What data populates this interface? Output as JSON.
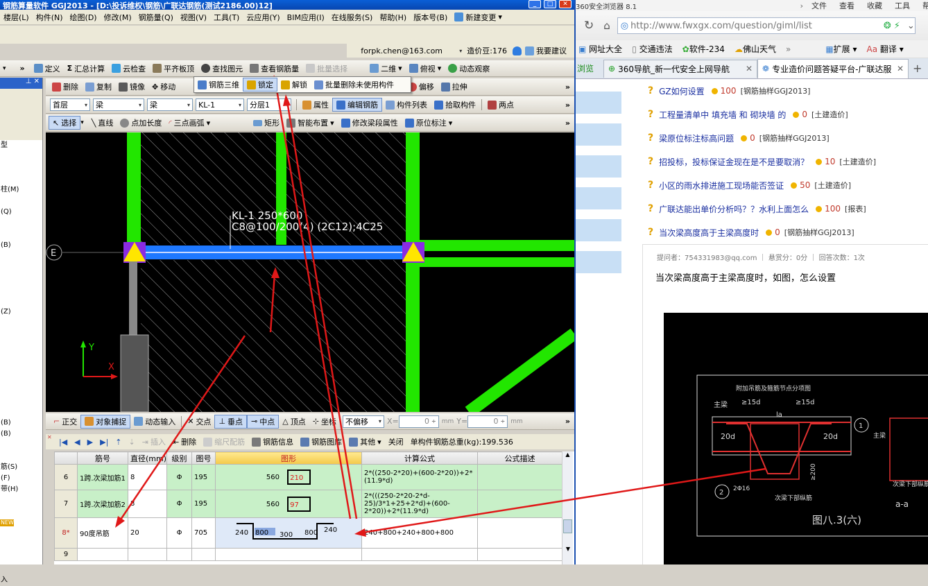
{
  "app": {
    "title": "钢筋算量软件 GGJ2013 - [D:\\投诉维权\\钢筋\\广联达钢筋(测试2186.00)12]",
    "menu": [
      "楼层(L)",
      "构件(N)",
      "绘图(D)",
      "修改(M)",
      "钢筋量(Q)",
      "视图(V)",
      "工具(T)",
      "云应用(Y)",
      "BIM应用(I)",
      "在线服务(S)",
      "帮助(H)",
      "版本号(B)",
      "新建变更"
    ],
    "account": {
      "email": "forpk.chen@163.com",
      "beans": "造价豆:176",
      "suggest": "我要建议"
    },
    "toolbar1": [
      "定义",
      "汇总计算",
      "云检查",
      "平齐板顶",
      "查找图元",
      "查看钢筋量",
      "批量选择",
      "二维",
      "俯视",
      "动态观察"
    ],
    "popup": [
      "钢筋三维",
      "锁定",
      "解锁",
      "批量删除未使用构件"
    ],
    "toolbar2": [
      "删除",
      "复制",
      "镜像",
      "移动",
      "对齐",
      "偏移",
      "拉伸"
    ],
    "combos": [
      "首层",
      "梁",
      "梁",
      "KL-1",
      "分层1"
    ],
    "toolbar3": [
      "属性",
      "编辑钢筋",
      "构件列表",
      "拾取构件",
      "两点"
    ],
    "toolbar4": [
      "选择",
      "直线",
      "点加长度",
      "三点画弧",
      "矩形",
      "智能布置",
      "修改梁段属性",
      "原位标注"
    ],
    "left_items": [
      "型",
      "",
      "",
      "",
      "柱(M)",
      "",
      "(Q)",
      "",
      "",
      "(B)",
      "",
      "",
      "",
      "",
      "",
      "(Z)",
      "",
      "",
      "",
      "",
      "",
      "",
      "",
      "",
      "",
      "(B)",
      "(B)",
      "",
      "",
      "筋(S)",
      "(F)",
      "带(H)",
      "",
      "",
      "NEW",
      "",
      "",
      "",
      "",
      "入"
    ],
    "canvas": {
      "beam_label1": "KL-1 250*600",
      "beam_label2": "C8@100/200(4) (2C12);4C25",
      "axis_e": "E",
      "axis_x": "X",
      "axis_y": "Y"
    },
    "statusbar": [
      "正交",
      "对象捕捉",
      "动态输入",
      "交点",
      "垂点",
      "中点",
      "顶点",
      "坐标",
      "不偏移"
    ],
    "status_x_label": "X=",
    "status_x": "0",
    "status_y_label": "Y=",
    "status_y": "0",
    "status_unit": "mm",
    "rebar_toolbar": [
      "插入",
      "删除",
      "缩尺配筋",
      "钢筋信息",
      "钢筋图库",
      "其他",
      "关闭"
    ],
    "total_weight": "单构件钢筋总重(kg):199.536",
    "table": {
      "headers": [
        "筋号",
        "直径(mm)",
        "级别",
        "图号",
        "图形",
        "计算公式",
        "公式描述"
      ],
      "rows": [
        {
          "idx": "6",
          "name": "1跨.次梁加筋1",
          "dia": "8",
          "grade": "Φ",
          "fig": "195",
          "shape_a": "560",
          "shape_b": "210",
          "formula": "2*((250-2*20)+(600-2*20))+2*(11.9*d)"
        },
        {
          "idx": "7",
          "name": "1跨.次梁加筋2",
          "dia": "8",
          "grade": "Φ",
          "fig": "195",
          "shape_a": "560",
          "shape_b": "97",
          "formula": "2*(((250-2*20-2*d-25)/3*1+25+2*d)+(600-2*20))+2*(11.9*d)"
        },
        {
          "idx": "8*",
          "name": "90度吊筋",
          "dia": "20",
          "grade": "Φ",
          "fig": "705",
          "shape_a": "240",
          "shape_b": "800",
          "shape_c": "300",
          "shape_d": "800",
          "shape_e": "240",
          "formula": "240+800+240+800+800"
        },
        {
          "idx": "9",
          "name": "",
          "dia": "",
          "grade": "",
          "fig": "",
          "formula": ""
        }
      ]
    }
  },
  "browser": {
    "title": "360安全浏览器 8.1",
    "menu": [
      "文件",
      "查看",
      "收藏",
      "工具",
      "帮助"
    ],
    "url": "http://www.fwxgx.com/question/giml/list",
    "bookmarks": [
      "网址大全",
      "交通违法",
      "软件-234",
      "佛山天气",
      "扩展",
      "翻译"
    ],
    "tabs": [
      "浏览",
      "360导航_新一代安全上网导航",
      "专业造价问题答疑平台-广联达服"
    ],
    "questions": [
      {
        "title": "GZ如何设置",
        "points": "100",
        "category": "[钢筋抽样GGJ2013]"
      },
      {
        "title": "工程量清单中 填充墙 和 砌块墙 的",
        "points": "0",
        "category": "[土建造价]"
      },
      {
        "title": "梁原位标注标高问题",
        "points": "0",
        "category": "[钢筋抽样GGJ2013]"
      },
      {
        "title": "招投标，投标保证金现在是不是要取消？",
        "points": "10",
        "category": "[土建造价]"
      },
      {
        "title": "小区的雨水排进施工现场能否签证",
        "points": "50",
        "category": "[土建造价]"
      },
      {
        "title": "广联达能出单价分析吗？？水利上面怎么",
        "points": "100",
        "category": "[报表]"
      },
      {
        "title": "当次梁高度高于主梁高度时",
        "points": "0",
        "category": "[钢筋抽样GGJ2013]"
      }
    ],
    "meta": "提问者：754331983@qq.com  ｜  悬赏分：0分  ｜  回答次数：1次",
    "question_text": "当次梁高度高于主梁高度时，如图，怎么设置",
    "drawing": {
      "heading": "附加吊筋及箍筋节点分项图",
      "main_beam": "主梁",
      "l15d_a": "≥15d",
      "l15d_b": "≥15d",
      "la": "la",
      "d20_a": "20d",
      "d20_b": "20d",
      "circle1": "1",
      "circle2": "2",
      "rebar": "2Φ16",
      "ge200": "≥200",
      "secondary": "次梁下部纵筋",
      "figure": "图八.3(六)",
      "section": "a-a",
      "side_main": "主梁",
      "side_sec": "次梁下部纵筋"
    }
  },
  "colors": {
    "green": "#22e600",
    "blue": "#1e78ff",
    "yellow": "#ffe600",
    "purple": "#8a2be2",
    "arrow": "#e01818"
  }
}
